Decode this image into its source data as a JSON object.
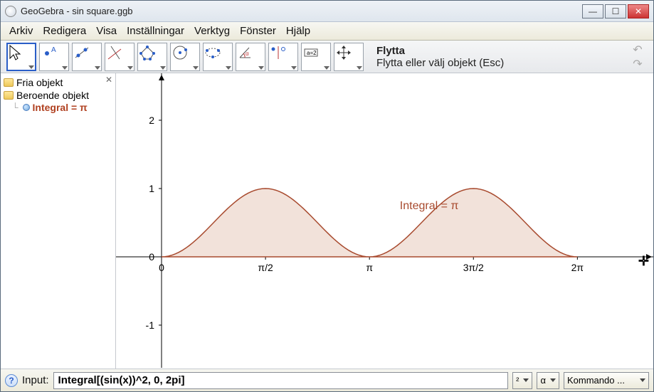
{
  "window": {
    "title": "GeoGebra - sin square.ggb"
  },
  "menu": {
    "items": [
      "Arkiv",
      "Redigera",
      "Visa",
      "Inställningar",
      "Verktyg",
      "Fönster",
      "Hjälp"
    ]
  },
  "tool_info": {
    "title": "Flytta",
    "hint": "Flytta eller välj objekt (Esc)"
  },
  "sidebar": {
    "free": "Fria objekt",
    "dep": "Beroende objekt",
    "integral": "Integral = π"
  },
  "input": {
    "label": "Input:",
    "value": "Integral[(sin(x))^2, 0, 2pi]",
    "combo_sq": "²",
    "combo_alpha": "α",
    "combo_cmd": "Kommando ..."
  },
  "chart_data": {
    "type": "area",
    "function": "sin(x)^2",
    "x_range": [
      0,
      6.2832
    ],
    "annotation": "Integral = π",
    "x_ticks": [
      {
        "v": 0,
        "label": "0"
      },
      {
        "v": 1.5708,
        "label": "π/2"
      },
      {
        "v": 3.1416,
        "label": "π"
      },
      {
        "v": 4.7124,
        "label": "3π/2"
      },
      {
        "v": 6.2832,
        "label": "2π"
      }
    ],
    "y_ticks": [
      {
        "v": -1,
        "label": "-1"
      },
      {
        "v": 0,
        "label": "0"
      },
      {
        "v": 1,
        "label": "1"
      },
      {
        "v": 2,
        "label": "2"
      }
    ],
    "y_range": [
      -1.4,
      2.4
    ],
    "integral_value": 3.1416,
    "series": [
      {
        "name": "sin²(x)",
        "samples": 120
      }
    ]
  }
}
